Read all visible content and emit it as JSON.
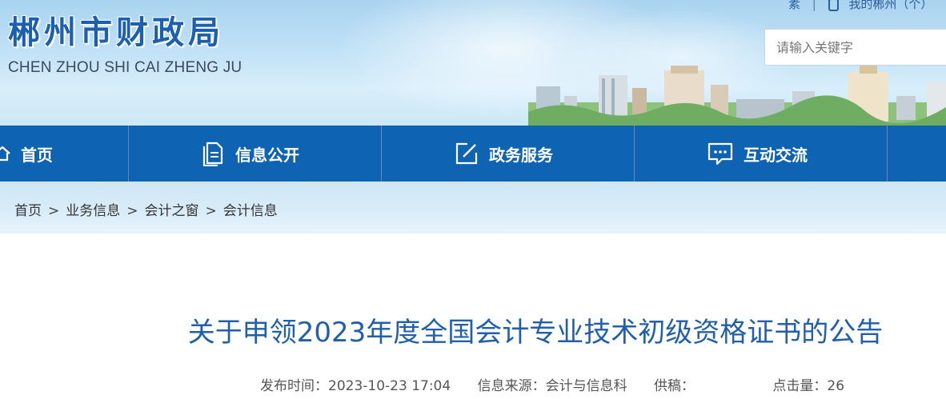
{
  "header": {
    "title": "郴州市财政局",
    "subtitle": "CHEN ZHOU SHI CAI ZHENG JU",
    "top_link_1": "素",
    "top_link_2": "我的郴州（个）",
    "search": {
      "placeholder": "请输入关键字"
    }
  },
  "nav": {
    "items": [
      {
        "label": "首页",
        "icon": "home-icon"
      },
      {
        "label": "信息公开",
        "icon": "document-icon"
      },
      {
        "label": "政务服务",
        "icon": "edit-icon"
      },
      {
        "label": "互动交流",
        "icon": "chat-icon"
      }
    ]
  },
  "breadcrumb": {
    "items": [
      "首页",
      "业务信息",
      "会计之窗",
      "会计信息"
    ],
    "separator": ">"
  },
  "article": {
    "title": "关于申领2023年度全国会计专业技术初级资格证书的公告",
    "publish_time_label": "发布时间：",
    "publish_time": "2023-10-23 17:04",
    "source_label": "信息来源：",
    "source": "会计与信息科",
    "contributor_label": "供稿：",
    "contributor": "",
    "hits_label": "点击量：",
    "hits": "26"
  },
  "colors": {
    "nav_bg": "#0f63b3",
    "title_blue": "#1f5fae",
    "banner_sky": "#c3e3f7"
  }
}
